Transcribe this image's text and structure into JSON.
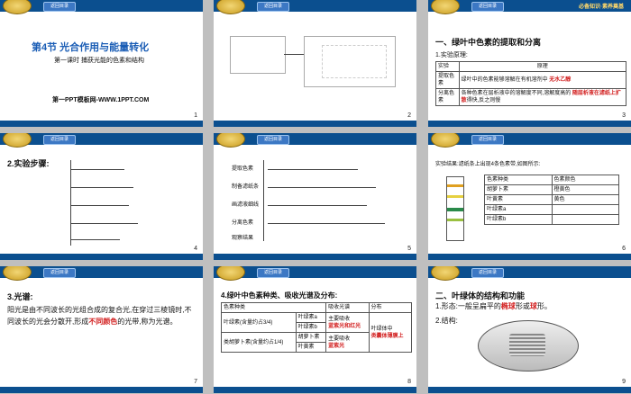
{
  "common": {
    "return_label": "返回目录",
    "brand": "必备知识·素养奠基"
  },
  "slides": [
    {
      "num": "1",
      "title": "第4节  光合作用与能量转化",
      "subtitle": "第一课时 捕获光能的色素和结构",
      "footer": "第一PPT模板网-WWW.1PPT.COM"
    },
    {
      "num": "2"
    },
    {
      "num": "3",
      "heading": "一、绿叶中色素的提取和分离",
      "sub": "1.实验原理:",
      "table": {
        "h1": "实验",
        "h2": "原理",
        "r1a": "提取色素",
        "r1b": "绿叶中的色素能够溶解在有机溶剂中",
        "r1c": "无水乙醇",
        "r2a": "分离色素",
        "r2b": "各种色素在层析液中的溶解度不同,溶解度高的",
        "r2c": "随层析液在滤纸上扩散",
        "r2d": "得快,反之则慢"
      }
    },
    {
      "num": "4",
      "heading": "2.实验步骤:"
    },
    {
      "num": "5",
      "lines": [
        "提取色素",
        "制备滤纸条",
        "画滤液细线",
        "分离色素",
        "观察结果"
      ]
    },
    {
      "num": "6",
      "caption": "实验结果:滤纸条上出现4条色素带,如图所示:",
      "table": {
        "h1": "色素种类",
        "h2": "色素颜色",
        "a": "胡萝卜素",
        "b": "橙黄色",
        "c": "叶黄素",
        "d": "黄色",
        "e": "叶绿素a",
        "f": "叶绿素b"
      }
    },
    {
      "num": "7",
      "heading": "3.光谱:",
      "body": "阳光是由不同波长的光组合成的复合光,在穿过三棱镜时,不同波长的光会分散开,形成",
      "blank": "不同颜色",
      "body2": "的光带,称为光谱。"
    },
    {
      "num": "8",
      "heading": "4.绿叶中色素种类、吸收光谱及分布:",
      "table": {
        "h1": "色素种类",
        "h2": "吸收光谱",
        "h3": "分布",
        "g1": "叶绿素(含量约占3/4)",
        "a": "叶绿素a",
        "b": "叶绿素b",
        "s1": "主要吸收",
        "r1": "蓝紫光和红光",
        "g2": "类胡萝卜素(含量约占1/4)",
        "c": "胡萝卜素",
        "d": "叶黄素",
        "s2": "主要吸收",
        "r2": "蓝紫光",
        "loc": "叶绿体中",
        "loc2": "类囊体薄膜上"
      }
    },
    {
      "num": "9",
      "heading": "二、叶绿体的结构和功能",
      "l1": "1.形态:一般呈扁平的",
      "r1": "椭球",
      "l1b": "形或",
      "r1b": "球",
      "l1c": "形。",
      "l2": "2.结构:"
    }
  ]
}
